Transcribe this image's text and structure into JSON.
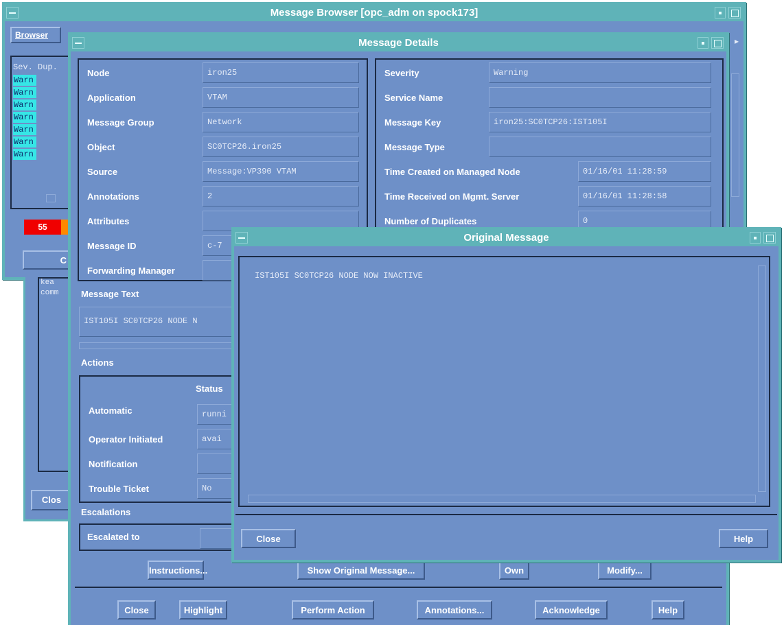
{
  "browser_window": {
    "title": "Message Browser  [opc_adm on spock173]",
    "menu_first": "Browser",
    "col_header": "Sev. Dup.",
    "severity_rows": [
      "Warn",
      "Warn",
      "Warn",
      "Warn",
      "Warn",
      "Warn",
      "Warn"
    ],
    "count_red": "55",
    "partial_button": "C",
    "clip_text_1": "kea",
    "clip_text_2": "comm",
    "close_label": "Clos",
    "arrow_glyph": "▸",
    "colors": {
      "red": "#f00000",
      "orange": "#ff8800",
      "cyan": "#36e6e6"
    }
  },
  "details_window": {
    "title": "Message Details",
    "left_fields": [
      {
        "label": "Node",
        "value": "iron25"
      },
      {
        "label": "Application",
        "value": "VTAM"
      },
      {
        "label": "Message Group",
        "value": "Network"
      },
      {
        "label": "Object",
        "value": "SC0TCP26.iron25"
      },
      {
        "label": "Source",
        "value": "Message:VP390 VTAM"
      },
      {
        "label": "Annotations",
        "value": "2"
      },
      {
        "label": "Attributes",
        "value": ""
      },
      {
        "label": "Message ID",
        "value": "c-7"
      },
      {
        "label": "Forwarding Manager",
        "value": ""
      }
    ],
    "right_fields": [
      {
        "label": "Severity",
        "value": "Warning"
      },
      {
        "label": "Service Name",
        "value": ""
      },
      {
        "label": "Message Key",
        "value": "iron25:SC0TCP26:IST105I"
      },
      {
        "label": "Message Type",
        "value": ""
      },
      {
        "label": "Time Created on Managed Node",
        "value": "01/16/01 11:28:59"
      },
      {
        "label": "Time Received on Mgmt. Server",
        "value": "01/16/01 11:28:58"
      },
      {
        "label": "Number of Duplicates",
        "value": "0"
      }
    ],
    "message_text_label": "Message Text",
    "message_text_value": "IST105I  SC0TCP26 NODE N",
    "actions_label": "Actions",
    "status_header": "Status",
    "action_rows": [
      {
        "label": "Automatic",
        "value": "runni"
      },
      {
        "label": "Operator Initiated",
        "value": "avai"
      },
      {
        "label": "Notification",
        "value": ""
      },
      {
        "label": "Trouble Ticket",
        "value": "No"
      }
    ],
    "escalations_label": "Escalations",
    "escalated_to_label": "Escalated to",
    "escalated_to_value": "",
    "buttons_row1": [
      "Instructions...",
      "Show Original Message...",
      "Own",
      "Modify..."
    ],
    "buttons_row2": [
      "Close",
      "Highlight",
      "Perform Action",
      "Annotations...",
      "Acknowledge",
      "Help"
    ]
  },
  "original_window": {
    "title": "Original Message",
    "text": "IST105I  SC0TCP26 NODE NOW INACTIVE",
    "close_label": "Close",
    "help_label": "Help"
  }
}
